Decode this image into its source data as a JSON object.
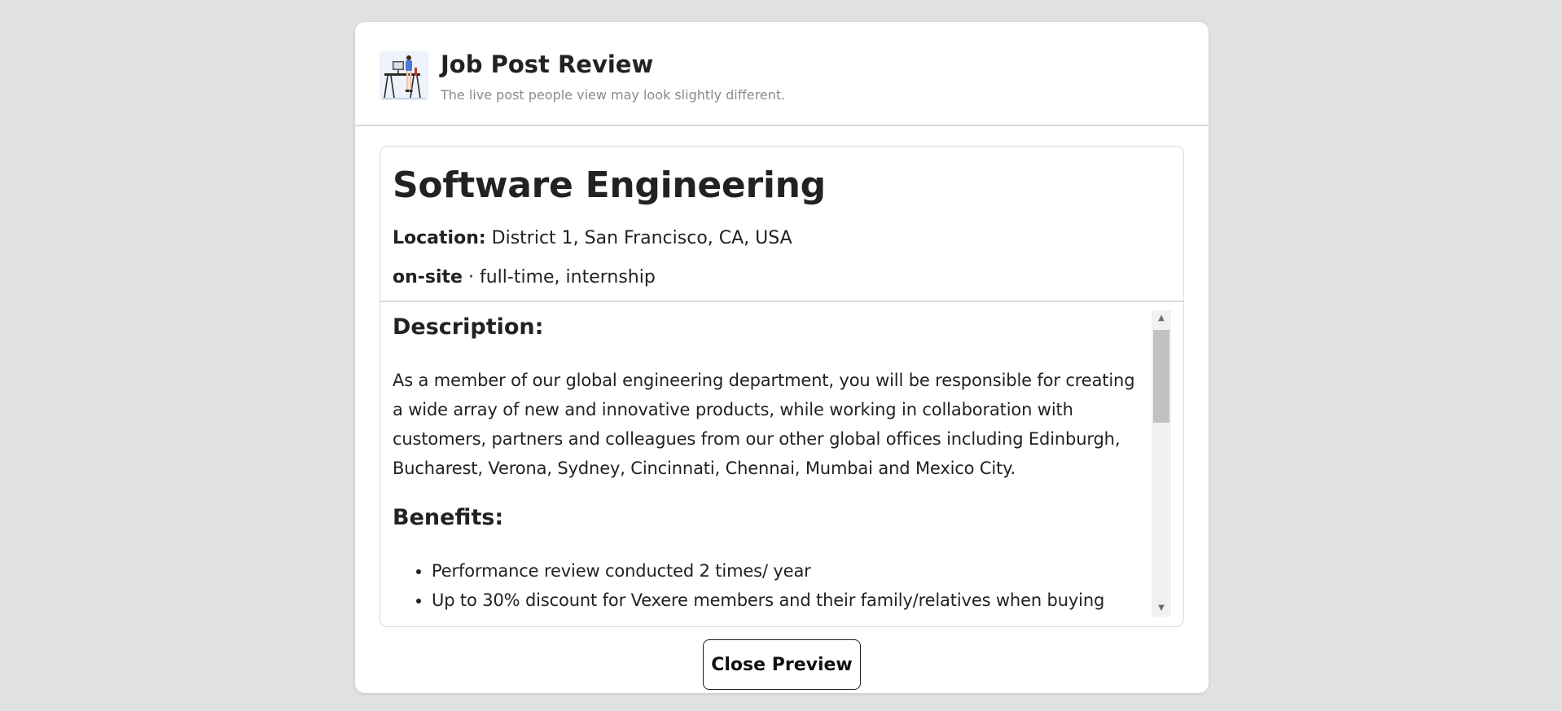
{
  "header": {
    "illustration_icon": "person-at-desk-illustration",
    "title": "Job Post Review",
    "subtitle": "The live post people view may look slightly different."
  },
  "post": {
    "title": "Software Engineering",
    "location_label": "Location:",
    "location_value": "District 1, San Francisco, CA, USA",
    "workplace_type": "on-site",
    "separator": "·",
    "employment_types": "full-time, internship",
    "description_heading": "Description:",
    "description_text": "As a member of our global engineering department, you will be responsible for creating a wide array of new and innovative products, while working in collaboration with customers, partners and colleagues from our other global offices including Edinburgh, Bucharest, Verona, Sydney, Cincinnati, Chennai, Mumbai and Mexico City.",
    "benefits_heading": "Benefits:",
    "benefits": [
      "Performance review conducted 2 times/ year",
      "Up to 30% discount for Vexere members and their family/relatives when buying"
    ]
  },
  "footer": {
    "close_label": "Close Preview"
  }
}
